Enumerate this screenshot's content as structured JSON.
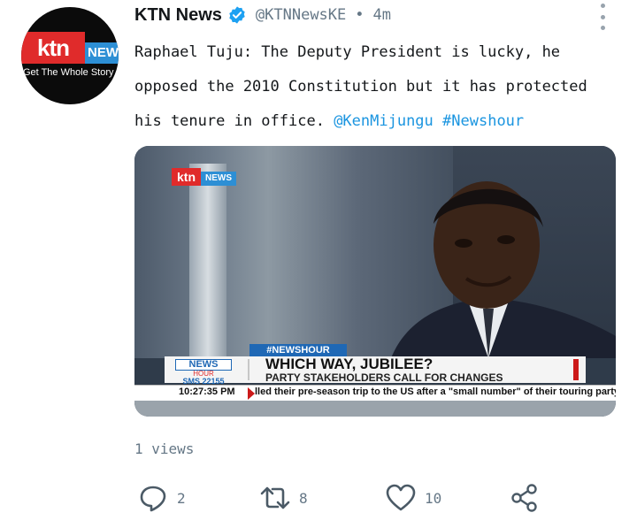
{
  "profile": {
    "avatar_logo_red": "ktn",
    "avatar_logo_blue": "NEWS",
    "avatar_tagline": "Get The Whole Story",
    "display_name": "KTN News",
    "handle": "@KTNNewsKE",
    "separator": "•",
    "time": "4m"
  },
  "tweet": {
    "text": "Raphael Tuju: The Deputy President is lucky, he opposed the 2010 Constitution but it has protected his tenure in office.",
    "mention": "@KenMijungu",
    "hashtag": "#Newshour"
  },
  "media": {
    "logo_red": "ktn",
    "logo_blue": "NEWS",
    "hashtag_tab": "#NEWSHOUR",
    "box_top": "NEWS",
    "box_mid": "HOUR",
    "box_sms": "SMS 22155",
    "headline": "WHICH WAY, JUBILEE?",
    "subheadline": "PARTY STAKEHOLDERS CALL FOR CHANGES",
    "ticker_time": "10:27:35 PM",
    "ticker_text": "lled their pre-season trip to the US after a \"small number\" of their touring party te"
  },
  "stats": {
    "views": "1 views",
    "replies": "2",
    "retweets": "8",
    "likes": "10"
  },
  "colors": {
    "accent": "#1b95e0",
    "text": "#14171a",
    "muted": "#657786",
    "ktn_red": "#e02b2b",
    "ktn_blue": "#2d8fd5"
  },
  "icons": [
    "verified-badge-icon",
    "more-options-icon",
    "reply-icon",
    "retweet-icon",
    "like-icon",
    "share-icon"
  ]
}
